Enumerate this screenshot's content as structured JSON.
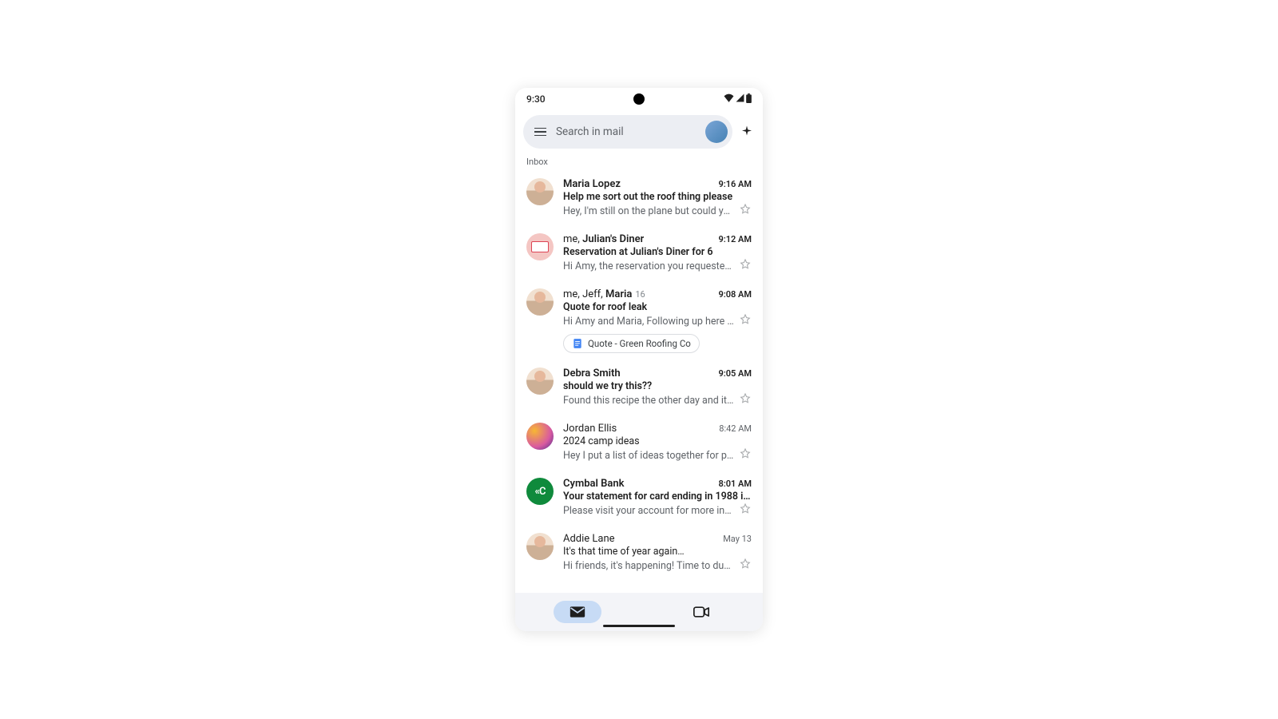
{
  "status": {
    "time": "9:30"
  },
  "search": {
    "placeholder": "Search in mail"
  },
  "section_label": "Inbox",
  "emails": [
    {
      "sender_plain": "",
      "sender_bold": "Maria Lopez",
      "count": "",
      "time": "9:16 AM",
      "subject": "Help me sort out the roof thing please",
      "snippet": "Hey, I'm still on the plane but could you repl…",
      "unread": true,
      "avatar": "person",
      "attachment": ""
    },
    {
      "sender_plain": "me, ",
      "sender_bold": "Julian's Diner",
      "count": "",
      "time": "9:12 AM",
      "subject": "Reservation at Julian's Diner for 6",
      "snippet": "Hi Amy, the reservation you requested is now",
      "unread": true,
      "avatar": "diner",
      "attachment": ""
    },
    {
      "sender_plain": "me, Jeff, ",
      "sender_bold": "Maria",
      "count": "16",
      "time": "9:08 AM",
      "subject": "Quote for roof leak",
      "snippet": "Hi Amy and Maria, Following up here t…",
      "unread": true,
      "avatar": "person",
      "attachment": "Quote - Green Roofing Co"
    },
    {
      "sender_plain": "",
      "sender_bold": "Debra Smith",
      "count": "",
      "time": "9:05 AM",
      "subject": "should we try this??",
      "snippet": "Found this recipe the other day and it might…",
      "unread": true,
      "avatar": "person",
      "attachment": ""
    },
    {
      "sender_plain": "Jordan Ellis",
      "sender_bold": "",
      "count": "",
      "time": "8:42 AM",
      "subject": "2024 camp ideas",
      "snippet": "Hey I put a list of ideas together for potenti…",
      "unread": false,
      "avatar": "color1",
      "attachment": ""
    },
    {
      "sender_plain": "",
      "sender_bold": "Cymbal Bank",
      "count": "",
      "time": "8:01 AM",
      "subject": "Your statement for card ending in 1988 i…",
      "snippet": "Please visit your account for more informati…",
      "unread": true,
      "avatar": "bank",
      "attachment": ""
    },
    {
      "sender_plain": "Addie Lane",
      "sender_bold": "",
      "count": "",
      "time": "May 13",
      "subject": "It's that time of year again…",
      "snippet": "Hi friends, it's happening! Time to dust off y…",
      "unread": false,
      "avatar": "person",
      "attachment": ""
    }
  ],
  "bank_initials": "«C"
}
